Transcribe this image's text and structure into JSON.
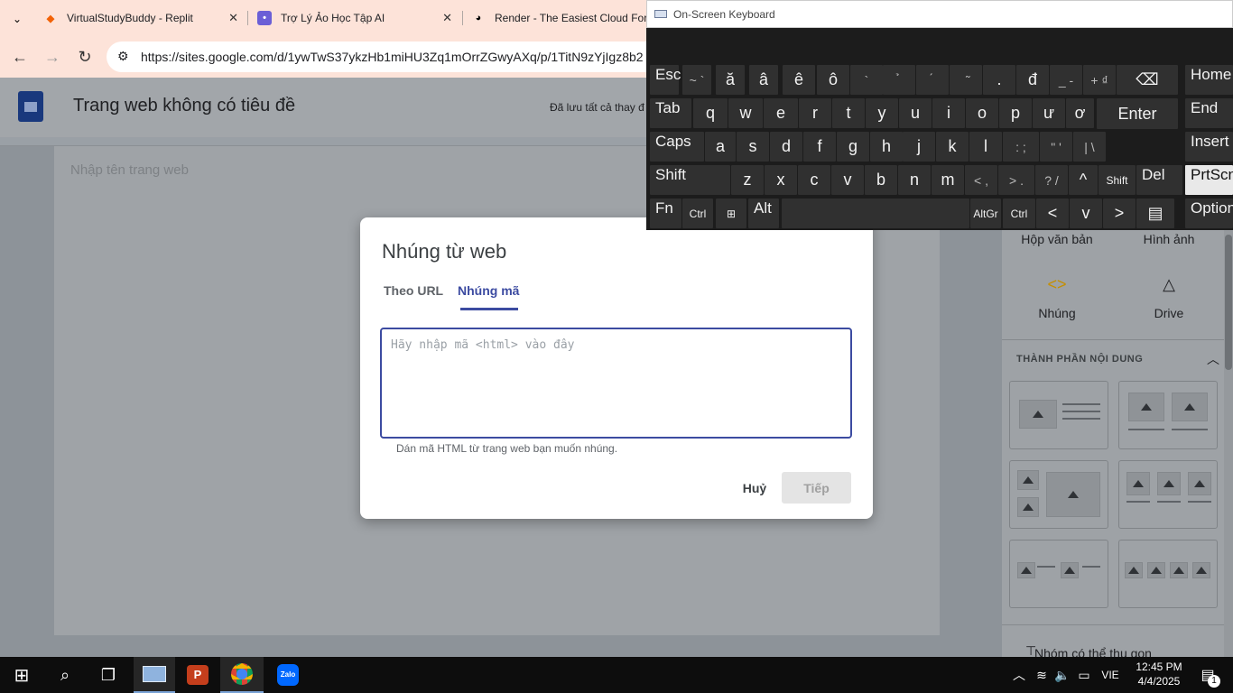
{
  "browser": {
    "tabs": [
      {
        "title": "VirtualStudyBuddy - Replit"
      },
      {
        "title": "Trợ Lý Ảo Học Tập AI"
      },
      {
        "title": "Render - The Easiest Cloud For A"
      }
    ],
    "url": "https://sites.google.com/d/1ywTwS37ykzHb1miHU3Zq1mOrrZGwyAXq/p/1TitN9zYjIgz8b2"
  },
  "sites": {
    "doc_title": "Trang web không có tiêu đề",
    "saved_status": "Đã lưu tất cả thay đ",
    "page_name_placeholder": "Nhập tên trang web",
    "right_panel": {
      "text_box": "Hộp văn bản",
      "image": "Hình ảnh",
      "embed": "Nhúng",
      "drive": "Drive",
      "content_section": "THÀNH PHẦN NỘI DUNG",
      "collapsible": "Nhóm có thể thu gọn"
    }
  },
  "dialog": {
    "title": "Nhúng từ web",
    "tab_url": "Theo URL",
    "tab_code": "Nhúng mã",
    "code_placeholder": "Hãy nhập mã <html> vào đây",
    "hint": "Dán mã HTML từ trang web bạn muốn nhúng.",
    "cancel": "Huỷ",
    "next": "Tiếp"
  },
  "osk": {
    "title": "On-Screen Keyboard",
    "rows": [
      [
        "Esc",
        "~ `",
        "ă",
        "â",
        "ê",
        "ô",
        "`",
        "̉",
        "́",
        "̃",
        ".",
        "đ",
        "_ -",
        "+ ₫",
        "⌫",
        "Home"
      ],
      [
        "Tab",
        "q",
        "w",
        "e",
        "r",
        "t",
        "y",
        "u",
        "i",
        "o",
        "p",
        "ư",
        "ơ",
        "Enter",
        "End"
      ],
      [
        "Caps",
        "a",
        "s",
        "d",
        "f",
        "g",
        "h",
        "j",
        "k",
        "l",
        ": ;",
        "\" '",
        "| \\",
        "Insert"
      ],
      [
        "Shift",
        "z",
        "x",
        "c",
        "v",
        "b",
        "n",
        "m",
        "< ,",
        "> .",
        "? /",
        "^",
        "Shift",
        "Del",
        "PrtScn"
      ],
      [
        "Fn",
        "Ctrl",
        "⊞",
        "Alt",
        "",
        "AltGr",
        "Ctrl",
        "<",
        "v",
        ">",
        "▤",
        "Options"
      ]
    ]
  },
  "taskbar": {
    "time": "12:45 PM",
    "date": "4/4/2025",
    "language": "VIE",
    "notifications": "1"
  }
}
